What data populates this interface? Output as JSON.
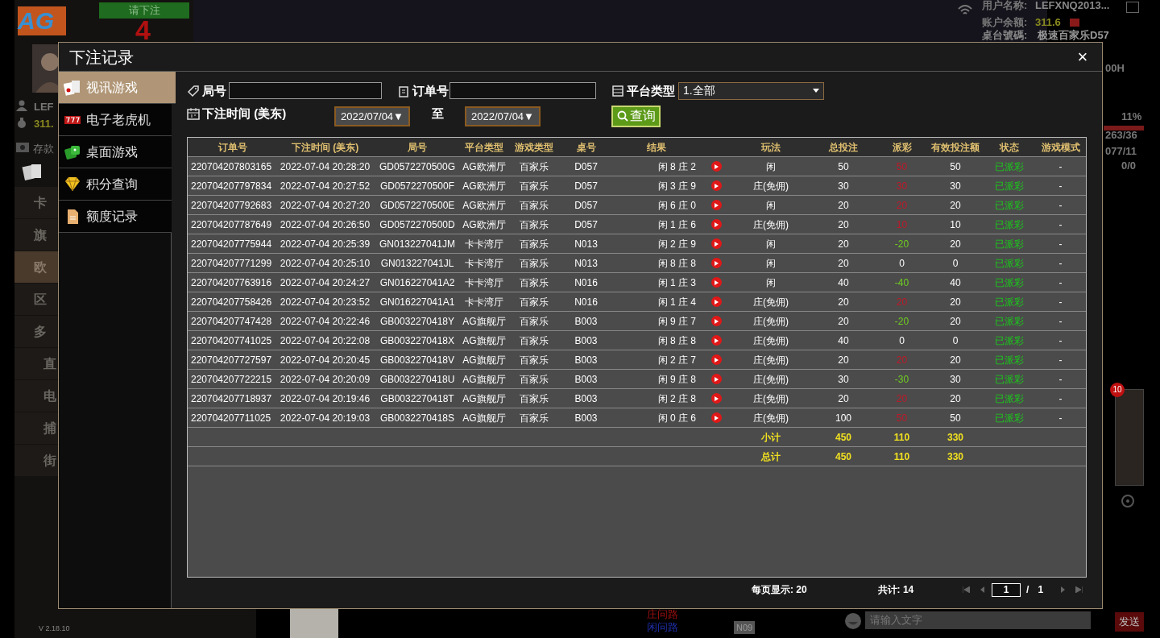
{
  "background": {
    "logo": "AG",
    "bet_prompt": "请下注",
    "countdown": "4",
    "user_label": "用户名称:",
    "user_name": "LEFXNQ2013...",
    "balance_label": "账户余额:",
    "balance": "311.6",
    "table_label": "桌台號碼:",
    "table_name": "极速百家乐D57",
    "left_user": "LEF",
    "left_balance": "311.",
    "deposit": "存款",
    "lobby_items": [
      {
        "label": "卡",
        "selected": false
      },
      {
        "label": "旗",
        "selected": false
      },
      {
        "label": "欧",
        "selected": true
      },
      {
        "label": "区",
        "selected": false
      },
      {
        "label": "多",
        "selected": false
      },
      {
        "label": "直",
        "selected": false
      },
      {
        "label": "电",
        "selected": false
      },
      {
        "label": "捕",
        "selected": false
      },
      {
        "label": "街",
        "selected": false
      }
    ],
    "stats": [
      "00H",
      "11%",
      "263/36",
      "077/11",
      "0/0"
    ],
    "roads": [
      "庄问路",
      "闲问路"
    ],
    "room": "N09",
    "chat_placeholder": "请输入文字",
    "send": "发送",
    "version": "V 2.18.10",
    "badge": "10"
  },
  "dialog": {
    "title": "下注记录",
    "close": "×",
    "sidebar": [
      {
        "label": "视讯游戏",
        "selected": true
      },
      {
        "label": "电子老虎机",
        "selected": false
      },
      {
        "label": "桌面游戏",
        "selected": false
      },
      {
        "label": "积分查询",
        "selected": false
      },
      {
        "label": "额度记录",
        "selected": false
      }
    ],
    "filters": {
      "round_label": "局号",
      "order_label": "订单号",
      "platform_label": "平台类型",
      "platform_value": "1.全部",
      "time_label": "下注时间 (美东)",
      "date_from": "2022/07/04▼",
      "to_label": "至",
      "date_to": "2022/07/04▼",
      "query": "查询"
    },
    "table": {
      "columns": [
        "订单号",
        "下注时间 (美东)",
        "局号",
        "平台类型",
        "游戏类型",
        "桌号",
        "结果",
        "",
        "玩法",
        "总投注",
        "派彩",
        "有效投注额",
        "状态",
        "游戏模式"
      ],
      "rows": [
        {
          "order": "220704207803165",
          "time": "2022-07-04 20:28:20",
          "round": "GD0572270500G",
          "platform": "AG欧洲厅",
          "game": "百家乐",
          "table": "D057",
          "result": "闲 8 庄 2",
          "play": "闲",
          "bet": "50",
          "payout": "50",
          "color": "#c01828",
          "valid": "50",
          "status": "已派彩",
          "mode": "-"
        },
        {
          "order": "220704207797834",
          "time": "2022-07-04 20:27:52",
          "round": "GD0572270500F",
          "platform": "AG欧洲厅",
          "game": "百家乐",
          "table": "D057",
          "result": "闲 3 庄 9",
          "play": "庄(免佣)",
          "bet": "30",
          "payout": "30",
          "color": "#c01828",
          "valid": "30",
          "status": "已派彩",
          "mode": "-"
        },
        {
          "order": "220704207792683",
          "time": "2022-07-04 20:27:20",
          "round": "GD0572270500E",
          "platform": "AG欧洲厅",
          "game": "百家乐",
          "table": "D057",
          "result": "闲 6 庄 0",
          "play": "闲",
          "bet": "20",
          "payout": "20",
          "color": "#c01828",
          "valid": "20",
          "status": "已派彩",
          "mode": "-"
        },
        {
          "order": "220704207787649",
          "time": "2022-07-04 20:26:50",
          "round": "GD0572270500D",
          "platform": "AG欧洲厅",
          "game": "百家乐",
          "table": "D057",
          "result": "闲 1 庄 6",
          "play": "庄(免佣)",
          "bet": "20",
          "payout": "10",
          "color": "#c01828",
          "valid": "10",
          "status": "已派彩",
          "mode": "-"
        },
        {
          "order": "220704207775944",
          "time": "2022-07-04 20:25:39",
          "round": "GN013227041JM",
          "platform": "卡卡湾厅",
          "game": "百家乐",
          "table": "N013",
          "result": "闲 2 庄 9",
          "play": "闲",
          "bet": "20",
          "payout": "-20",
          "color": "#70d020",
          "valid": "20",
          "status": "已派彩",
          "mode": "-"
        },
        {
          "order": "220704207771299",
          "time": "2022-07-04 20:25:10",
          "round": "GN013227041JL",
          "platform": "卡卡湾厅",
          "game": "百家乐",
          "table": "N013",
          "result": "闲 8 庄 8",
          "play": "闲",
          "bet": "20",
          "payout": "0",
          "color": "#ffffff",
          "valid": "0",
          "status": "已派彩",
          "mode": "-"
        },
        {
          "order": "220704207763916",
          "time": "2022-07-04 20:24:27",
          "round": "GN016227041A2",
          "platform": "卡卡湾厅",
          "game": "百家乐",
          "table": "N016",
          "result": "闲 1 庄 3",
          "play": "闲",
          "bet": "40",
          "payout": "-40",
          "color": "#70d020",
          "valid": "40",
          "status": "已派彩",
          "mode": "-"
        },
        {
          "order": "220704207758426",
          "time": "2022-07-04 20:23:52",
          "round": "GN016227041A1",
          "platform": "卡卡湾厅",
          "game": "百家乐",
          "table": "N016",
          "result": "闲 1 庄 4",
          "play": "庄(免佣)",
          "bet": "20",
          "payout": "20",
          "color": "#c01828",
          "valid": "20",
          "status": "已派彩",
          "mode": "-"
        },
        {
          "order": "220704207747428",
          "time": "2022-07-04 20:22:46",
          "round": "GB0032270418Y",
          "platform": "AG旗舰厅",
          "game": "百家乐",
          "table": "B003",
          "result": "闲 9 庄 7",
          "play": "庄(免佣)",
          "bet": "20",
          "payout": "-20",
          "color": "#70d020",
          "valid": "20",
          "status": "已派彩",
          "mode": "-"
        },
        {
          "order": "220704207741025",
          "time": "2022-07-04 20:22:08",
          "round": "GB0032270418X",
          "platform": "AG旗舰厅",
          "game": "百家乐",
          "table": "B003",
          "result": "闲 8 庄 8",
          "play": "庄(免佣)",
          "bet": "40",
          "payout": "0",
          "color": "#ffffff",
          "valid": "0",
          "status": "已派彩",
          "mode": "-"
        },
        {
          "order": "220704207727597",
          "time": "2022-07-04 20:20:45",
          "round": "GB0032270418V",
          "platform": "AG旗舰厅",
          "game": "百家乐",
          "table": "B003",
          "result": "闲 2 庄 7",
          "play": "庄(免佣)",
          "bet": "20",
          "payout": "20",
          "color": "#c01828",
          "valid": "20",
          "status": "已派彩",
          "mode": "-"
        },
        {
          "order": "220704207722215",
          "time": "2022-07-04 20:20:09",
          "round": "GB0032270418U",
          "platform": "AG旗舰厅",
          "game": "百家乐",
          "table": "B003",
          "result": "闲 9 庄 8",
          "play": "庄(免佣)",
          "bet": "30",
          "payout": "-30",
          "color": "#70d020",
          "valid": "30",
          "status": "已派彩",
          "mode": "-"
        },
        {
          "order": "220704207718937",
          "time": "2022-07-04 20:19:46",
          "round": "GB0032270418T",
          "platform": "AG旗舰厅",
          "game": "百家乐",
          "table": "B003",
          "result": "闲 2 庄 8",
          "play": "庄(免佣)",
          "bet": "20",
          "payout": "20",
          "color": "#c01828",
          "valid": "20",
          "status": "已派彩",
          "mode": "-"
        },
        {
          "order": "220704207711025",
          "time": "2022-07-04 20:19:03",
          "round": "GB0032270418S",
          "platform": "AG旗舰厅",
          "game": "百家乐",
          "table": "B003",
          "result": "闲 0 庄 6",
          "play": "庄(免佣)",
          "bet": "100",
          "payout": "50",
          "color": "#c01828",
          "valid": "50",
          "status": "已派彩",
          "mode": "-"
        }
      ],
      "summary": [
        {
          "label": "小计",
          "bet": "450",
          "payout": "110",
          "valid": "330"
        },
        {
          "label": "总计",
          "bet": "450",
          "payout": "110",
          "valid": "330"
        }
      ]
    },
    "pager": {
      "per_page": "每页显示: 20",
      "total": "共计: 14",
      "page": "1",
      "slash": "/",
      "pages": "1"
    }
  }
}
